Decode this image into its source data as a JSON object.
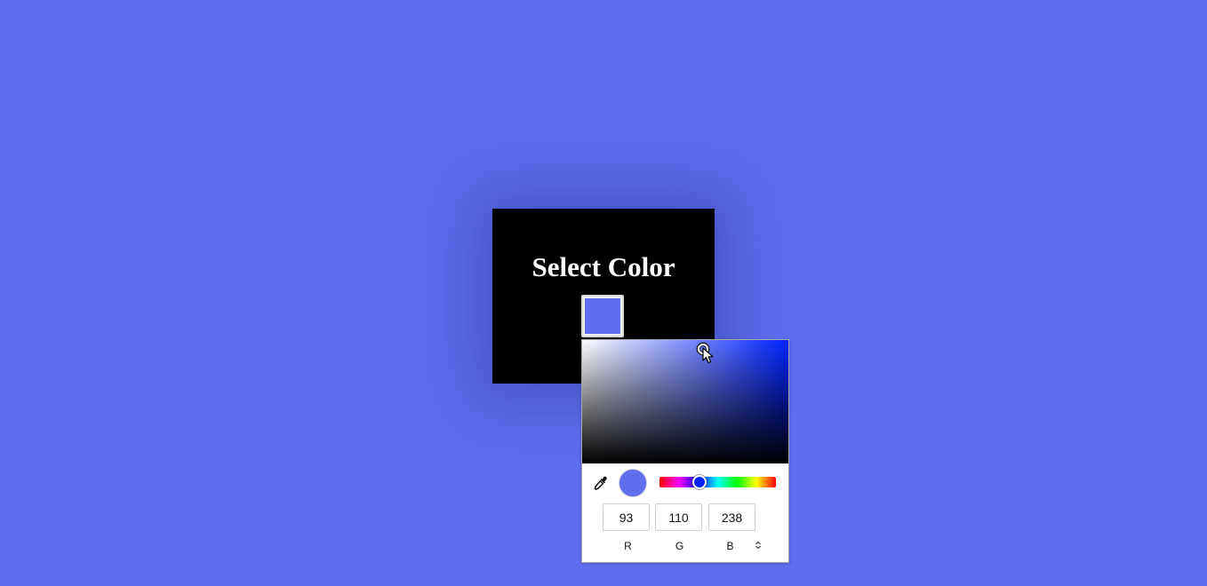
{
  "card": {
    "title": "Select Color",
    "background_color": "#000000"
  },
  "page": {
    "background_color": "#5d6eee"
  },
  "color_input": {
    "value": "#5d6eee"
  },
  "picker": {
    "hue_color": "#0022ff",
    "current_color": "#5d6eee",
    "rgb": {
      "r": "93",
      "g": "110",
      "b": "238"
    },
    "labels": {
      "r": "R",
      "g": "G",
      "b": "B"
    },
    "icons": {
      "eyedropper": "eyedropper-icon",
      "mode_toggle": "up-down-arrows-icon"
    }
  }
}
